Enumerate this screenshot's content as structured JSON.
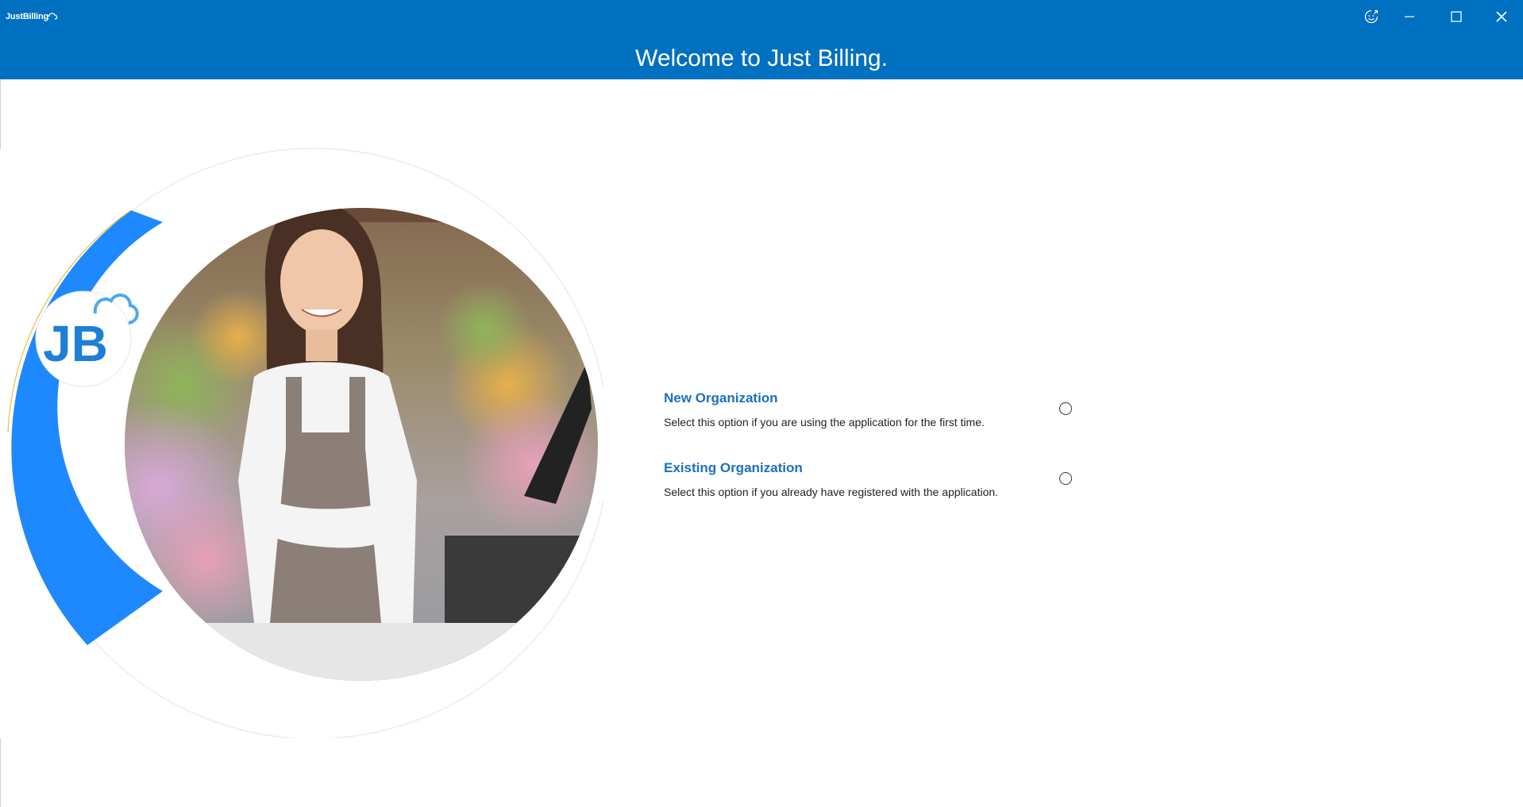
{
  "window": {
    "app_logo_text": "JustBilling",
    "title": "Welcome to Just Billing.",
    "controls": {
      "feedback_icon": "feedback-smiley-icon",
      "minimize_icon": "minimize-icon",
      "maximize_icon": "maximize-icon",
      "close_icon": "close-icon"
    }
  },
  "hero": {
    "logo_text": "JB",
    "image": "shopkeeper-photo"
  },
  "options": [
    {
      "title": "New Organization",
      "description": "Select this option if you are using the application for the first time.",
      "selected": false
    },
    {
      "title": "Existing Organization",
      "description": "Select this option if you already have registered with the application.",
      "selected": false
    }
  ],
  "colors": {
    "titlebar": "#0070c0",
    "accent_arc": "#1e88ff",
    "option_title": "#1a6fc0"
  }
}
